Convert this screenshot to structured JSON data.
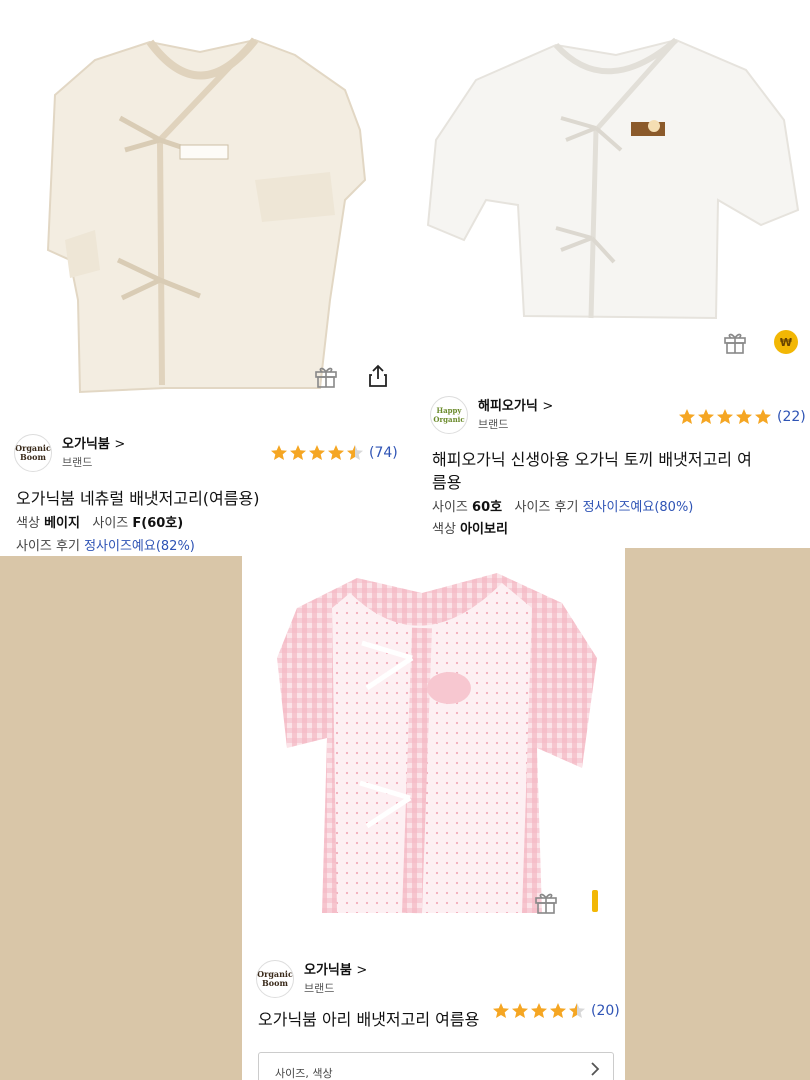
{
  "colors": {
    "link_blue": "#2f54b5",
    "star": "#f5a623",
    "page_bg": "#d9c6a8"
  },
  "cards": [
    {
      "brand": {
        "logo_text": "Organic Boom",
        "name": "오가닉붐",
        "chevron": ">",
        "sub": "브랜드"
      },
      "rating": {
        "stars": 4.5,
        "count": "(74)"
      },
      "title": "오가닉붐 네츄럴 배냇저고리(여름용)",
      "option1": {
        "color_label": "색상",
        "color_value": "베이지",
        "size_label": "사이즈",
        "size_value": "F(60호)"
      },
      "review": {
        "label": "사이즈 후기",
        "value": "정사이즈예요(82%)"
      },
      "icons": [
        "gift-icon",
        "share-icon"
      ]
    },
    {
      "brand": {
        "logo_text": "Happy Organic",
        "name": "해피오가닉",
        "chevron": ">",
        "sub": "브랜드"
      },
      "rating": {
        "stars": 5,
        "count": "(22)"
      },
      "title_line1": "해피오가닉 신생아용 오가닉 토끼 배냇저고리 여",
      "title_line2": "름용",
      "option1": {
        "size_label": "사이즈",
        "size_value": "60호",
        "review_label": "사이즈 후기",
        "review_value": "정사이즈예요(80%)"
      },
      "option2": {
        "color_label": "색상",
        "color_value": "아이보리"
      },
      "coin_symbol": "₩",
      "icons": [
        "gift-icon",
        "won-coin-icon"
      ]
    },
    {
      "brand": {
        "logo_text": "Organic Boom",
        "name": "오가닉붐",
        "chevron": ">",
        "sub": "브랜드"
      },
      "rating": {
        "stars": 4.5,
        "count": "(20)"
      },
      "title": "오가닉붐 아리 배냇저고리 여름용",
      "select": {
        "label": "사이즈, 색상"
      },
      "icons": [
        "gift-icon"
      ]
    }
  ]
}
